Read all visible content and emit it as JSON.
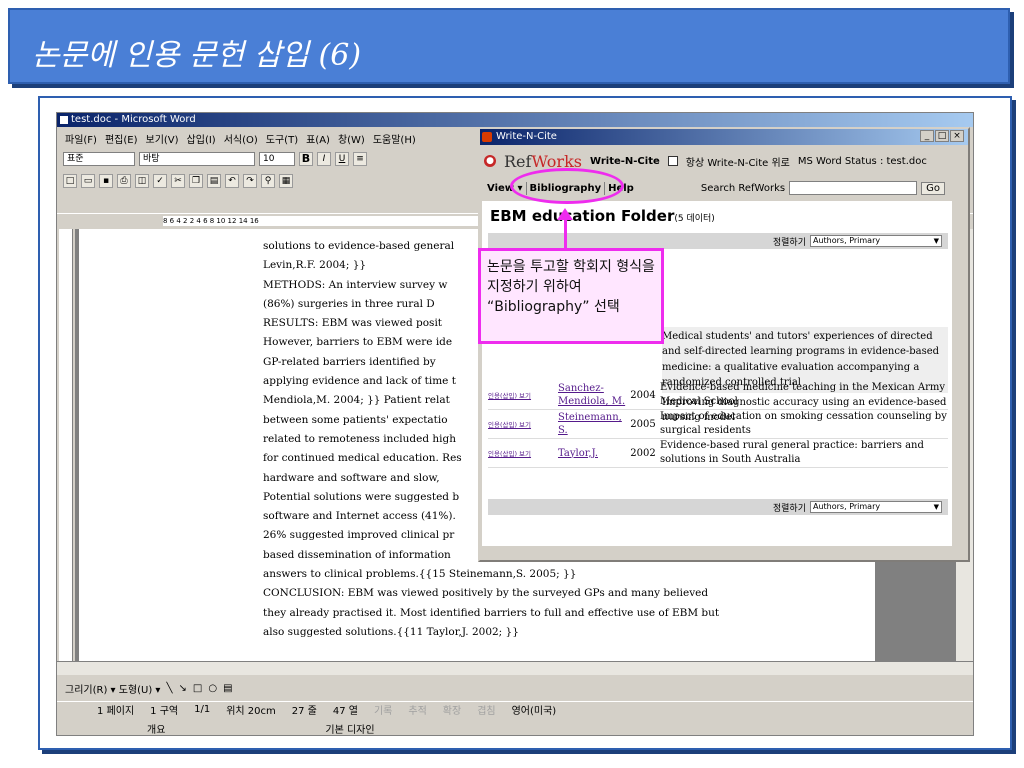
{
  "slide": {
    "title": "논문에 인용 문헌 삽입 (6)"
  },
  "word": {
    "title": "test.doc - Microsoft Word",
    "menu": [
      "파일(F)",
      "편집(E)",
      "보기(V)",
      "삽입(I)",
      "서식(O)",
      "도구(T)",
      "표(A)",
      "창(W)",
      "도움말(H)"
    ],
    "style_box": "표준",
    "font_box": "바탕",
    "size_box": "10",
    "ruler_text": "8 6 4 2 2 4 6 8 10 12 14 16",
    "doc_lines": [
      "solutions to evidence-based general",
      "Levin,R.F. 2004; }}",
      "METHODS: An interview survey w",
      "(86%) surgeries in three rural D",
      "RESULTS: EBM was viewed posit",
      "However, barriers to EBM were ide",
      "GP-related barriers identified by",
      "applying evidence and lack of time t",
      "Mendiola,M. 2004; }} Patient relat",
      "between some patients' expectatio",
      "related to remoteness included high",
      "for continued medical education. Res",
      "hardware and software and slow,",
      "Potential solutions were suggested b",
      "software and Internet access (41%).",
      "26% suggested improved clinical pr",
      "based dissemination of information",
      "answers to clinical problems.{{15 Steinemann,S. 2005; }}",
      " CONCLUSION: EBM was viewed positively by the surveyed GPs and many believed",
      "they already practised it. Most identified barriers to full and effective use of EBM but",
      "also suggested solutions.{{11 Taylor,J. 2002; }}"
    ],
    "draw_toolbar": "그리기(R) ▾   도형(U) ▾",
    "status": {
      "page": "1 페이지",
      "section": "1 구역",
      "pages": "1/1",
      "position": "위치 20cm",
      "line": "27 줄",
      "col": "47 열",
      "rec": "기록",
      "trk": "추적",
      "ext": "확장",
      "ovr": "겹침",
      "lang": "영어(미국)"
    },
    "taskbar": {
      "left": "개요",
      "right": "기본 디자인"
    }
  },
  "wnc": {
    "title": "Write-N-Cite",
    "logo_ref": "Ref",
    "logo_works": "Works",
    "app_label": "Write-N-Cite",
    "always_on_top": "항상 Write-N-Cite 위로",
    "status": "MS Word Status : test.doc",
    "nav": [
      "View ▾",
      "Bibliography",
      "Help"
    ],
    "search_label": "Search RefWorks",
    "go_label": "Go",
    "folder_title": "EBM education Folder",
    "folder_count": "(5 데이터)",
    "sort_label": "정렬하기",
    "sort_value": "Authors, Primary",
    "top_refs": [
      "Medical students' and tutors' experiences of directed and self-directed learning programs in evidence-based medicine: a qualitative evaluation accompanying a randomized controlled trial",
      "Improving diagnostic accuracy using an evidence-based nursing model"
    ],
    "refs": [
      {
        "action": "인용(삽입) 보기",
        "author": "Sanchez-Mendiola, M.",
        "year": "2004",
        "title": "Evidence-based medicine teaching in the Mexican Army Medical School"
      },
      {
        "action": "인용(삽입) 보기",
        "author": "Steinemann, S.",
        "year": "2005",
        "title": "Impact of education on smoking cessation counseling by surgical residents"
      },
      {
        "action": "인용(삽입) 보기",
        "author": "Taylor,J.",
        "year": "2002",
        "title": "Evidence-based rural general practice: barriers and solutions in South Australia"
      }
    ]
  },
  "callout": {
    "text": "논문을 투고할 학회지 형식을 지정하기 위하여 “Bibliography” 선택"
  },
  "colors": {
    "header": "#4a7fd6",
    "callout_border": "#ee2cee",
    "callout_fill": "#ffe6ff"
  }
}
